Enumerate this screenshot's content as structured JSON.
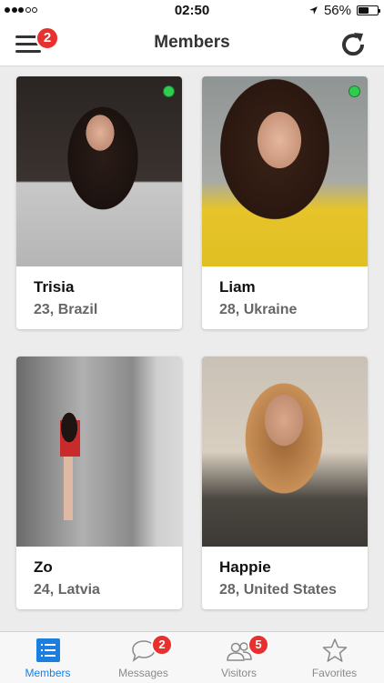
{
  "status_bar": {
    "time": "02:50",
    "battery_percent": "56%",
    "battery_level": 0.56
  },
  "nav": {
    "title": "Members",
    "menu_badge": "2"
  },
  "members": [
    {
      "name": "Trisia",
      "info": "23, Brazil",
      "online": true
    },
    {
      "name": "Liam",
      "info": "28, Ukraine",
      "online": true
    },
    {
      "name": "Zo",
      "info": "24, Latvia",
      "online": false
    },
    {
      "name": "Happie",
      "info": "28, United States",
      "online": false
    }
  ],
  "tabs": [
    {
      "label": "Members",
      "active": true,
      "icon": "list-icon"
    },
    {
      "label": "Messages",
      "badge": "2",
      "icon": "chat-bubble-icon"
    },
    {
      "label": "Visitors",
      "badge": "5",
      "icon": "people-icon"
    },
    {
      "label": "Favorites",
      "icon": "star-icon"
    }
  ],
  "colors": {
    "accent": "#1a7fe0",
    "badge": "#e8302f",
    "online": "#2fcc4f"
  }
}
